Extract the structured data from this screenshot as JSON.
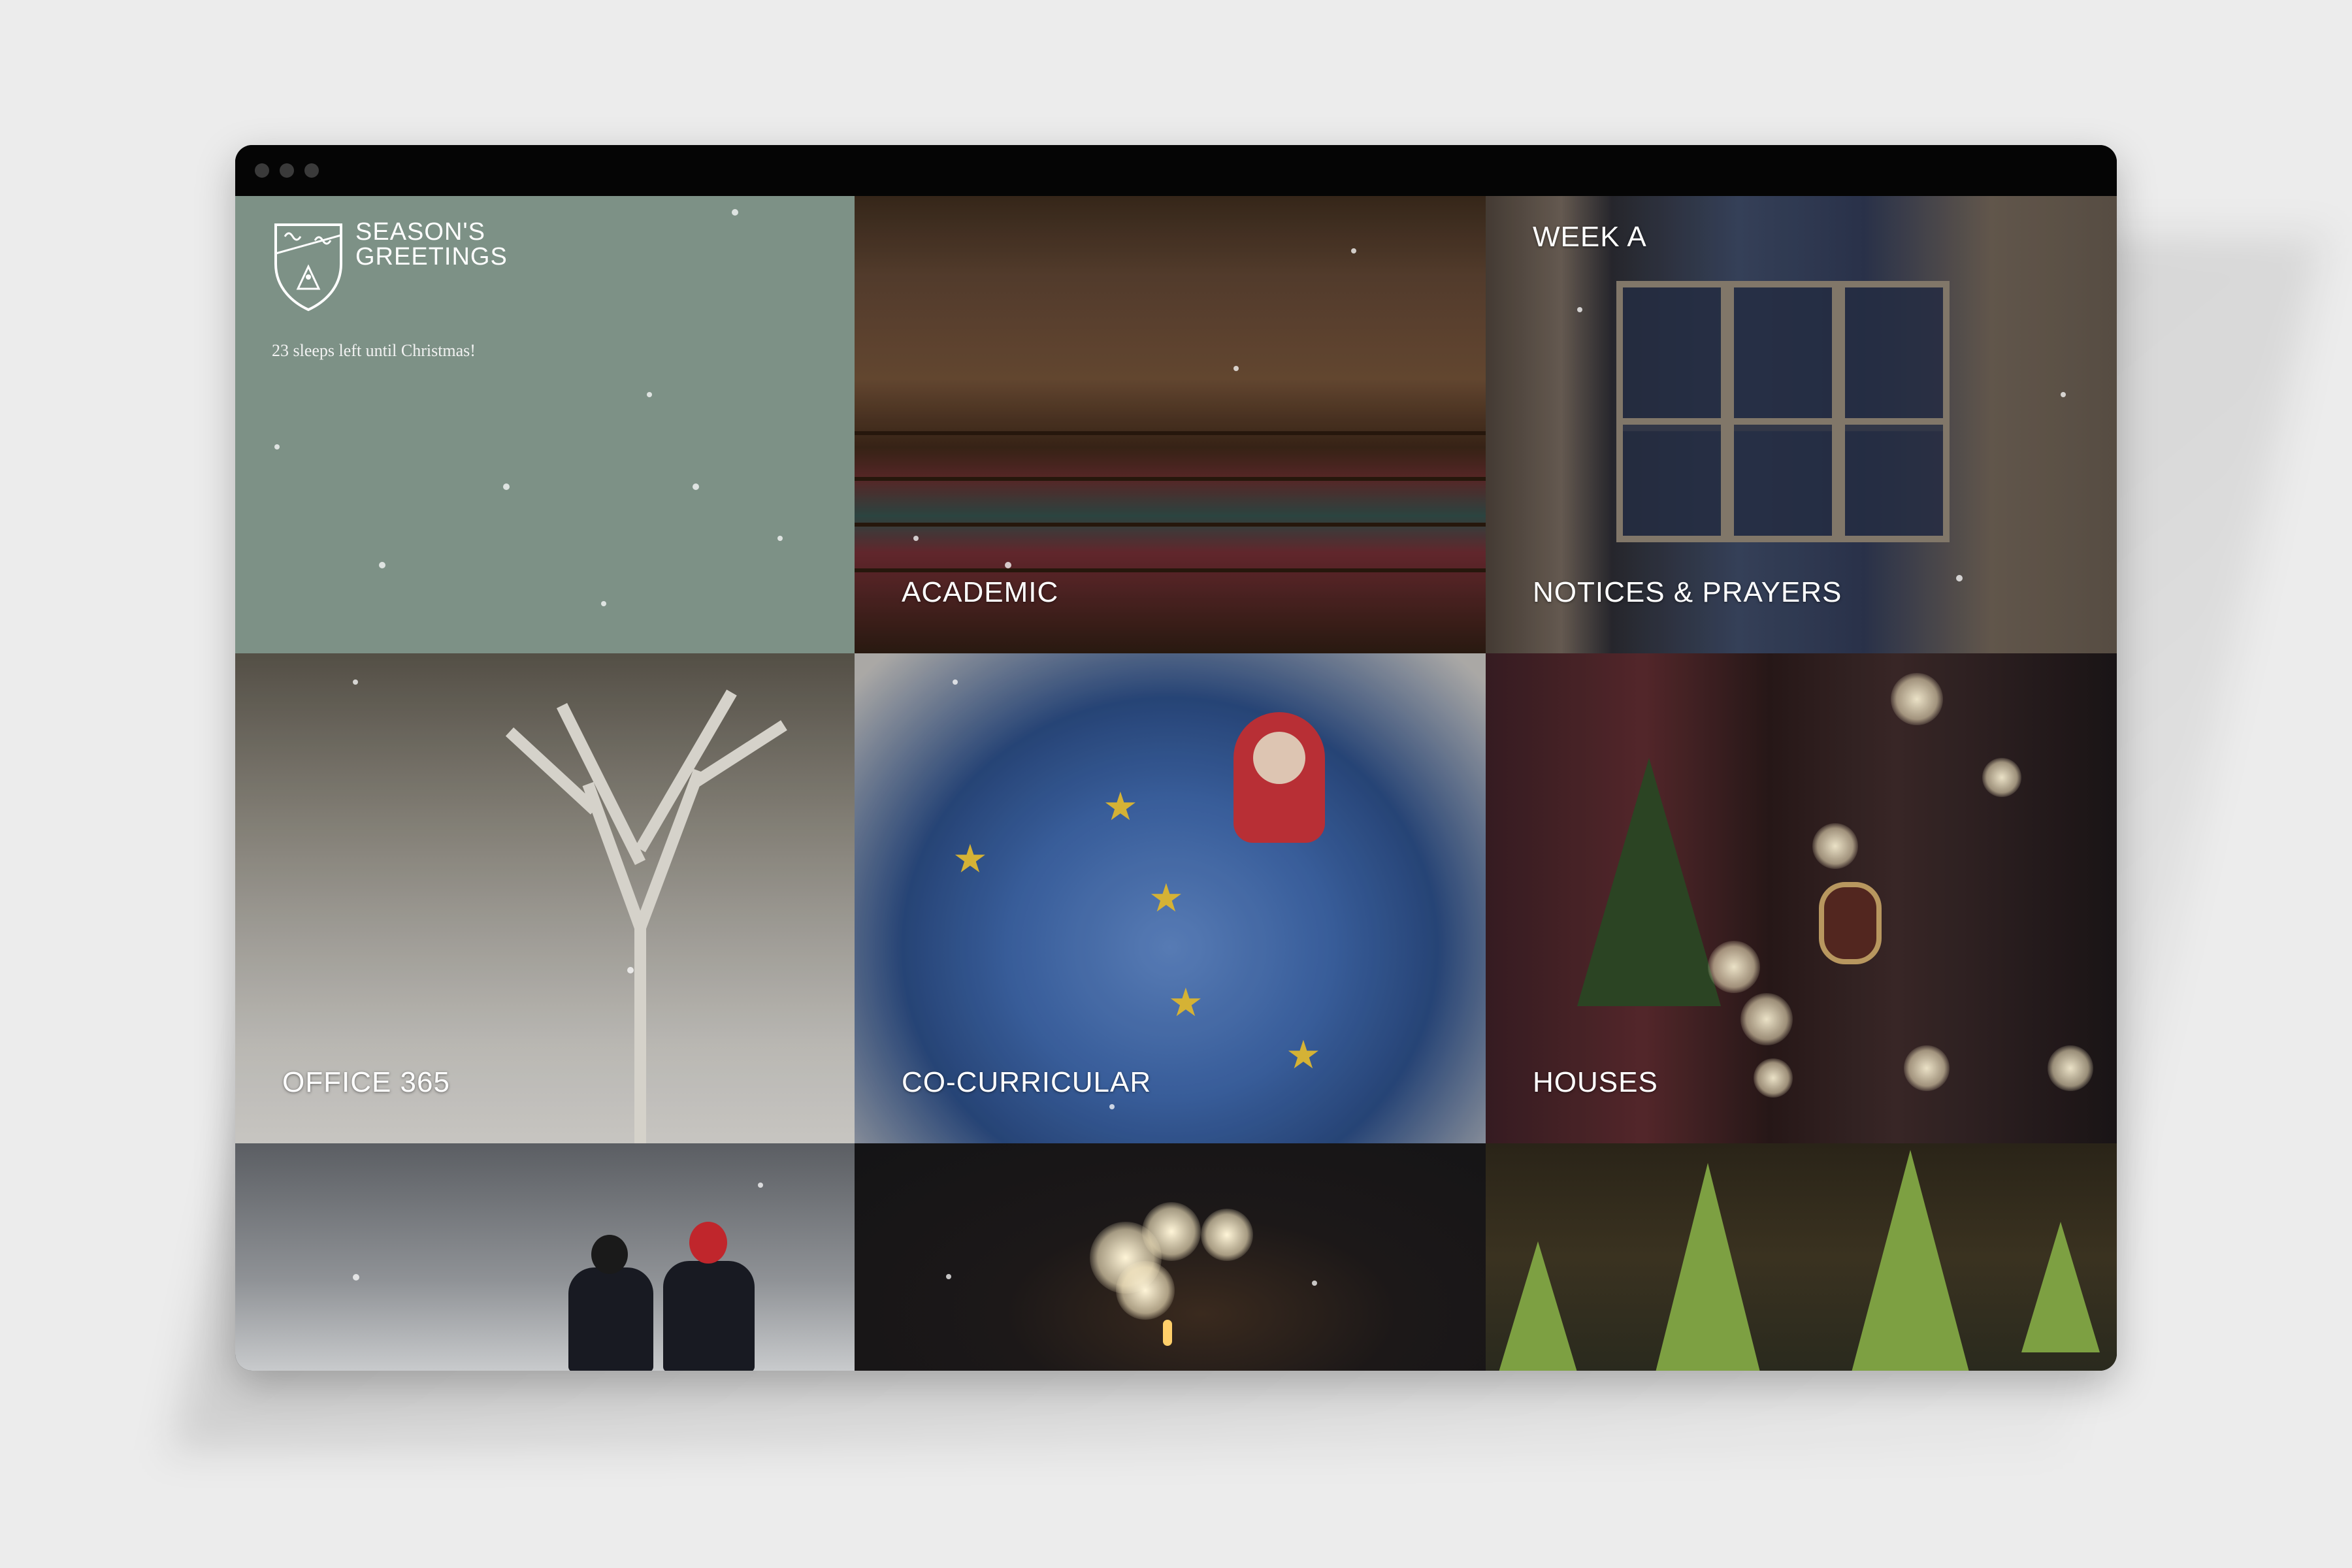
{
  "header": {
    "brand_line1": "SEASON'S",
    "brand_line2": "GREETINGS",
    "countdown": "23 sleeps left until Christmas!"
  },
  "tiles": {
    "week": "WEEK A",
    "academic": "ACADEMIC",
    "notices": "NOTICES & PRAYERS",
    "office": "OFFICE 365",
    "cocurricular": "CO-CURRICULAR",
    "houses": "HOUSES"
  },
  "icons": {
    "crest": "school-crest-icon",
    "window_controls": [
      "window-dot-icon",
      "window-dot-icon",
      "window-dot-icon"
    ]
  },
  "colors": {
    "greeting_tile": "#7d9186",
    "label_text": "#ffffff",
    "window_frame": "#000000"
  }
}
